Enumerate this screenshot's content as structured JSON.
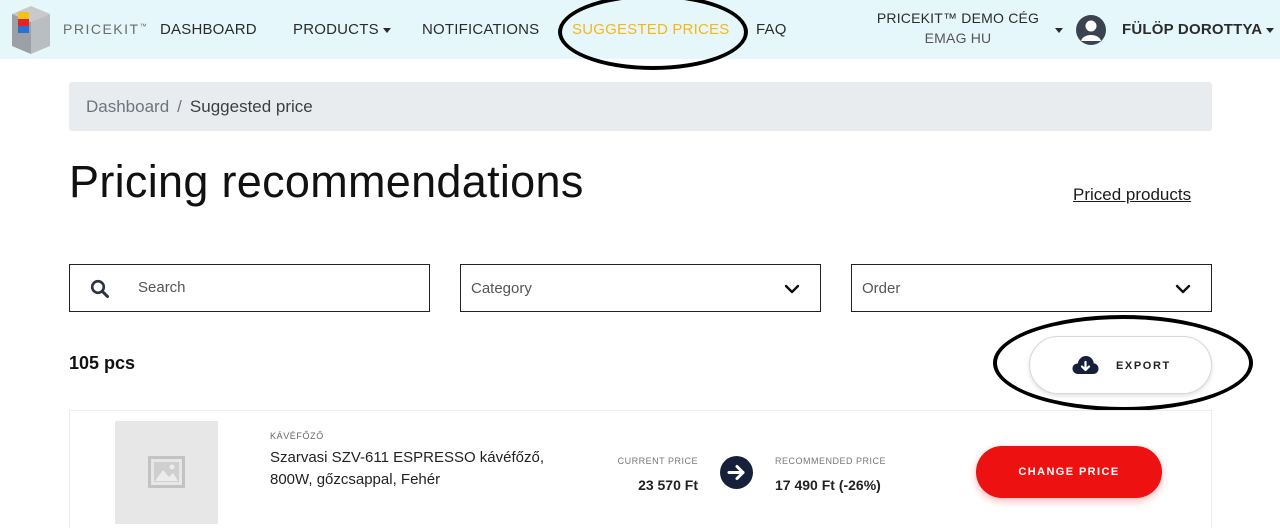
{
  "navbar": {
    "brand": "PRICEKIT",
    "brand_tm": "™",
    "items": [
      {
        "label": "DASHBOARD"
      },
      {
        "label": "PRODUCTS"
      },
      {
        "label": "NOTIFICATIONS"
      },
      {
        "label": "SUGGESTED PRICES",
        "active": true
      },
      {
        "label": "FAQ"
      }
    ],
    "company_name": "PRICEKIT™ DEMO CÉG",
    "company_store": "EMAG HU",
    "user_name": "FÜLÖP DOROTTYA"
  },
  "breadcrumb": {
    "home": "Dashboard",
    "separator": "/",
    "current": "Suggested price"
  },
  "page": {
    "title": "Pricing recommendations",
    "priced_products_link": "Priced products"
  },
  "filters": {
    "search_placeholder": "Search",
    "category_label": "Category",
    "order_label": "Order"
  },
  "results": {
    "count": "105 pcs",
    "export_label": "EXPORT"
  },
  "product": {
    "category": "KÁVÉFŐZŐ",
    "name": "Szarvasi SZV-611 ESPRESSO kávéfőző, 800W, gőzcsappal, Fehér",
    "current_price_label": "CURRENT PRICE",
    "current_price": "23 570 Ft",
    "recommended_price_label": "RECOMMENDED PRICE",
    "recommended_price": "17 490 Ft (-26%)",
    "change_price_label": "CHANGE PRICE"
  },
  "colors": {
    "navbar_bg": "#e6f7fb",
    "active_nav": "#f2b818",
    "primary_red": "#ee1111",
    "dark_navy": "#17203a"
  },
  "icons": [
    "pricekit-logo",
    "chevron-down-icon",
    "user-avatar-icon",
    "search-icon",
    "cloud-download-icon",
    "image-placeholder-icon",
    "arrow-right-icon"
  ]
}
